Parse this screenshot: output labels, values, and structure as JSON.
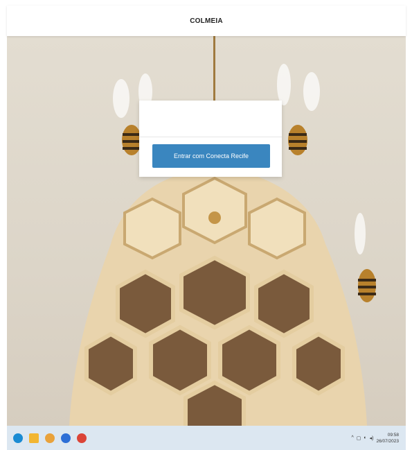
{
  "app": {
    "title": "COLMEIA"
  },
  "login": {
    "button_label": "Entrar com Conecta Recife"
  },
  "taskbar": {
    "icons": [
      "browser-icon",
      "file-explorer-icon",
      "chrome-icon",
      "z-app-icon",
      "chrome-alt-icon"
    ],
    "clock_time": "09:58",
    "clock_date": "26/07/2023"
  },
  "colors": {
    "button": "#3a86bf",
    "taskbar": "#dce7f1",
    "background": "#ddd6c9"
  }
}
